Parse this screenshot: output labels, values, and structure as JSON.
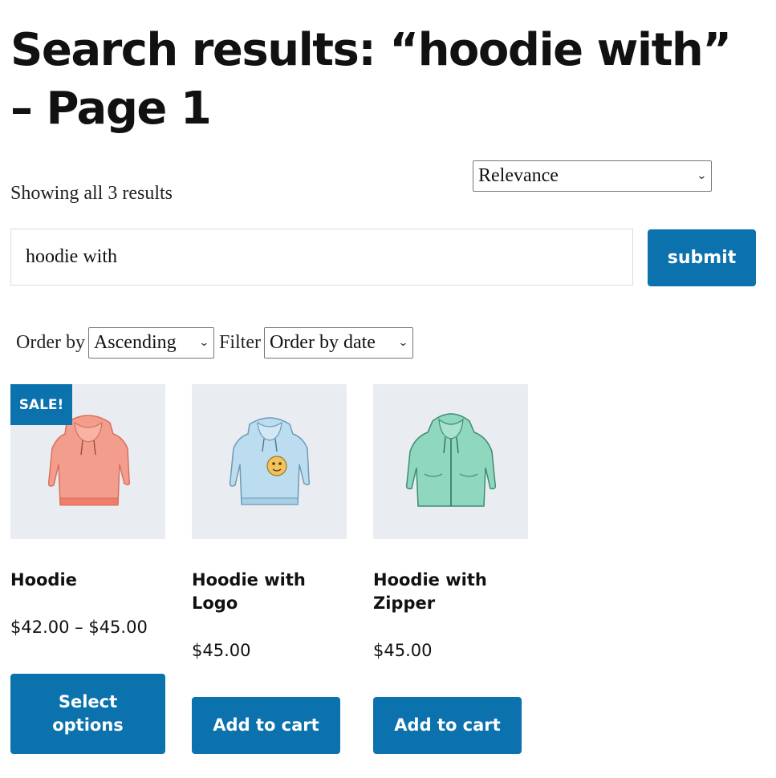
{
  "page": {
    "title": "Search results: “hoodie with” – Page 1"
  },
  "results": {
    "count_text": "Showing all 3 results",
    "sort_selected": "Relevance"
  },
  "search": {
    "value": "hoodie with",
    "submit_label": "submit"
  },
  "filters": {
    "order_label": "Order by",
    "order_selected": "Ascending",
    "filter_label": "Filter",
    "filter_selected": "Order by date"
  },
  "products": [
    {
      "title": "Hoodie",
      "price": "$42.00 – $45.00",
      "button": "Select options",
      "badge": "SALE!",
      "image_icon": "pink-hoodie-icon",
      "color": "#f39d8c"
    },
    {
      "title": "Hoodie with Logo",
      "price": "$45.00",
      "button": "Add to cart",
      "image_icon": "blue-logo-hoodie-icon",
      "color": "#bcdcef"
    },
    {
      "title": "Hoodie with Zipper",
      "price": "$45.00",
      "button": "Add to cart",
      "image_icon": "green-zip-hoodie-icon",
      "color": "#8fd7be"
    }
  ],
  "theme": {
    "accent": "#0b72ad",
    "thumb_bg": "#e9edf1"
  }
}
